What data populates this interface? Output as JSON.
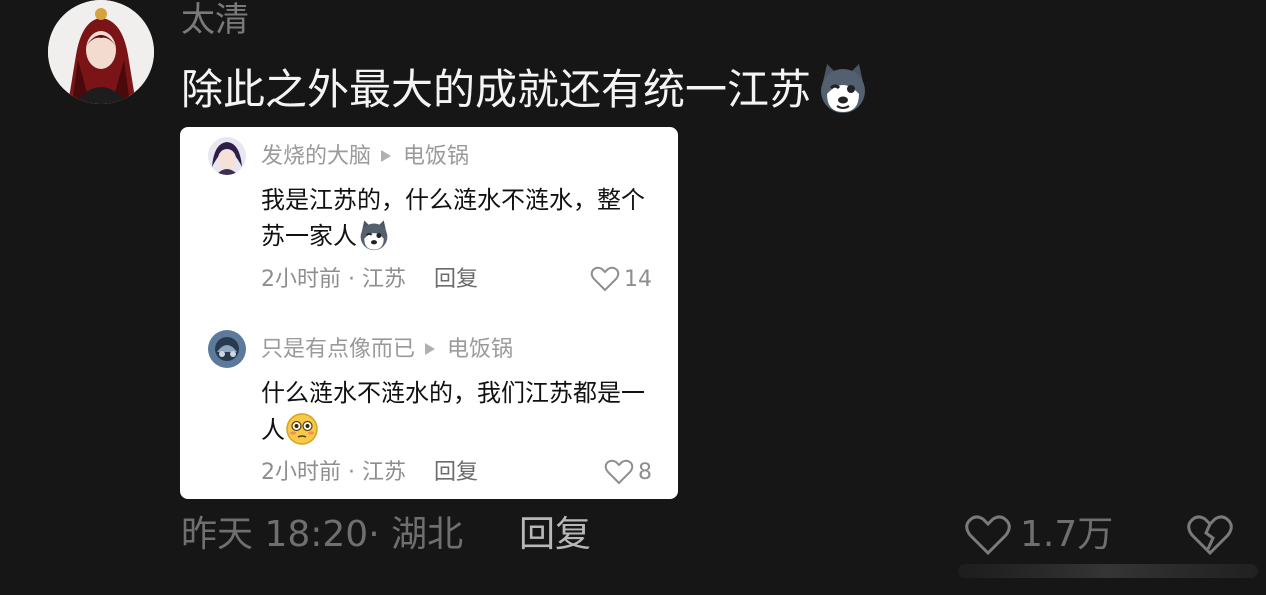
{
  "comment": {
    "username": "太清",
    "text": "除此之外最大的成就还有统一江苏",
    "emoji": "husky-emoji",
    "time": "昨天 18:20",
    "location": "湖北",
    "reply_label": "回复",
    "likes": "1.7万"
  },
  "embedded": {
    "replies": [
      {
        "user": "发烧的大脑",
        "target": "电饭锅",
        "line1": "我是江苏的，什么涟水不涟水，整个",
        "line2": "苏一家人",
        "emoji": "husky-emoji",
        "time": "2小时前",
        "location": "江苏",
        "reply_label": "回复",
        "likes": "14"
      },
      {
        "user": "只是有点像而已",
        "target": "电饭锅",
        "line1": "什么涟水不涟水的，我们江苏都是一",
        "line2": "人",
        "emoji": "flushed-emoji",
        "time": "2小时前",
        "location": "江苏",
        "reply_label": "回复",
        "likes": "8"
      }
    ]
  },
  "colors": {
    "background": "#161616",
    "card": "#ffffff",
    "text_primary": "#f4f4f4",
    "text_muted": "#7a7a7a"
  }
}
